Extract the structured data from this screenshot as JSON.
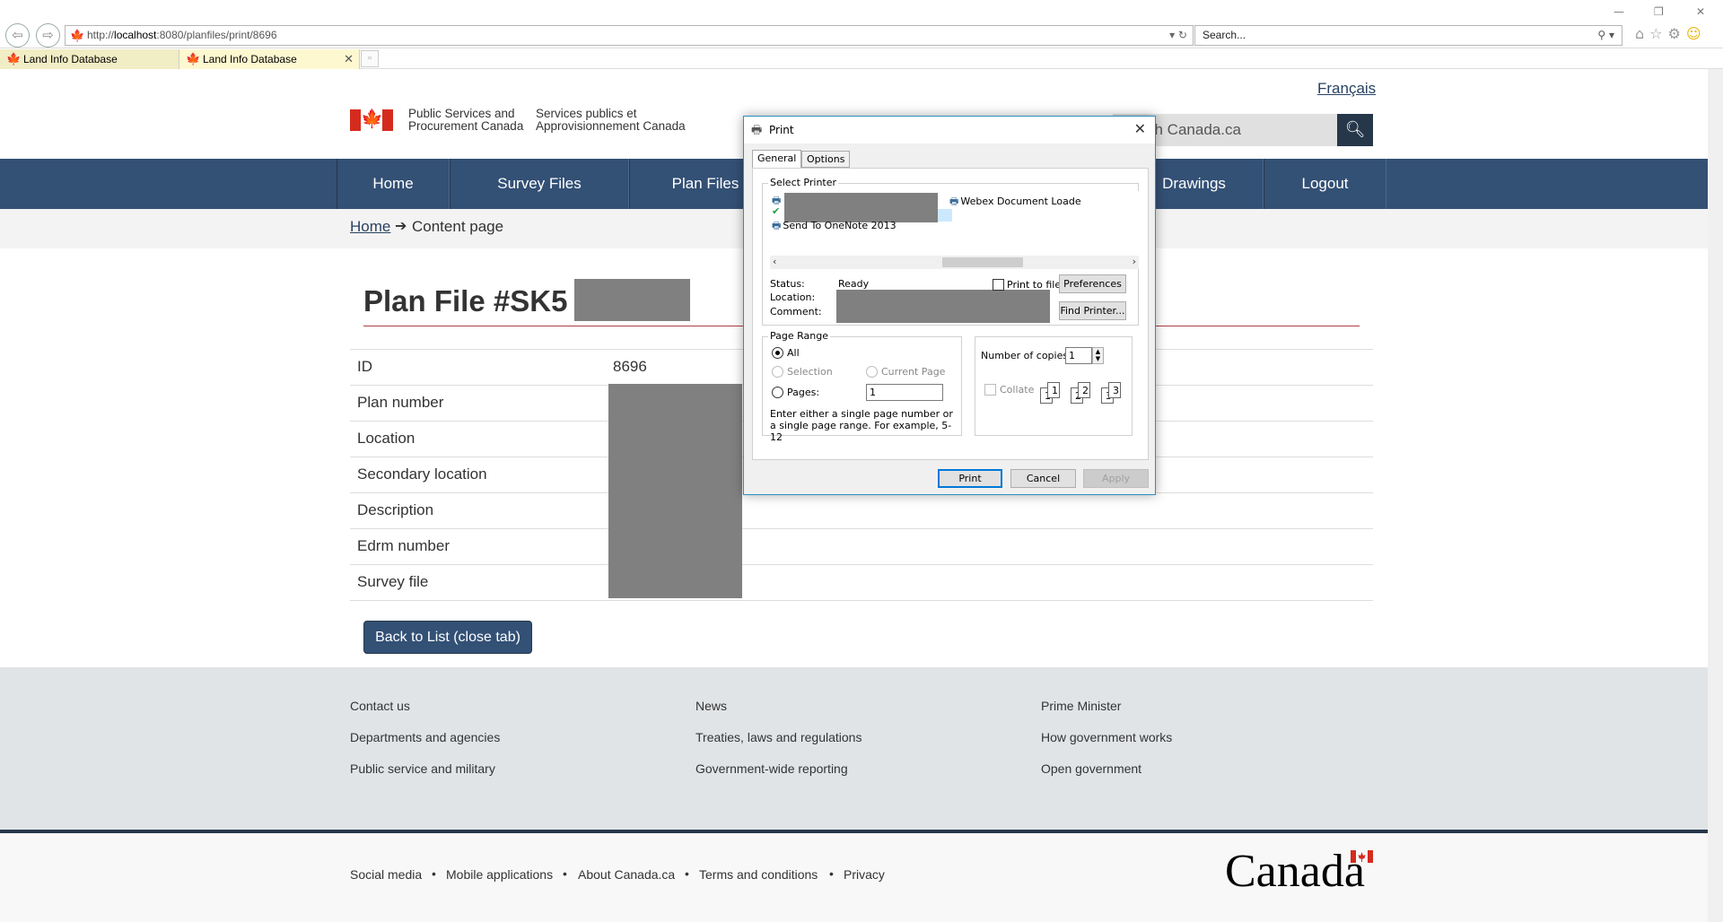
{
  "browser": {
    "url_prefix": "http://",
    "url_host": "localhost",
    "url_rest": ":8080/planfiles/print/8696",
    "search_placeholder": "Search...",
    "tabs": [
      {
        "label": "Land Info Database"
      },
      {
        "label": "Land Info Database"
      }
    ]
  },
  "header": {
    "language_link": "Français",
    "signature_en_1": "Public Services and",
    "signature_en_2": "Procurement Canada",
    "signature_fr_1": "Services publics et",
    "signature_fr_2": "Approvisionnement Canada",
    "search_placeholder": "ch Canada.ca"
  },
  "nav": {
    "items": [
      {
        "label": "Home"
      },
      {
        "label": "Survey Files"
      },
      {
        "label": "Plan Files"
      },
      {
        "label": "Drawings"
      },
      {
        "label": "Logout"
      }
    ]
  },
  "breadcrumb": {
    "home": "Home",
    "current": "Content page"
  },
  "main": {
    "title": "Plan File #SK5",
    "fields": [
      {
        "label": "ID",
        "value": "8696"
      },
      {
        "label": "Plan number",
        "value": ""
      },
      {
        "label": "Location",
        "value": ""
      },
      {
        "label": "Secondary location",
        "value": ""
      },
      {
        "label": "Description",
        "value": ""
      },
      {
        "label": "Edrm number",
        "value": ""
      },
      {
        "label": "Survey file",
        "value": ""
      }
    ],
    "back_button": "Back to List (close tab)"
  },
  "footer": {
    "col1": [
      "Contact us",
      "Departments and agencies",
      "Public service and military"
    ],
    "col2": [
      "News",
      "Treaties, laws and regulations",
      "Government-wide reporting"
    ],
    "col3": [
      "Prime Minister",
      "How government works",
      "Open government"
    ],
    "bottom_links": [
      "Social media",
      "Mobile applications",
      "About Canada.ca",
      "Terms and conditions",
      "Privacy"
    ],
    "separator": "•",
    "wordmark": "Canada"
  },
  "print_dialog": {
    "title": "Print",
    "tabs": [
      "General",
      "Options"
    ],
    "select_printer_label": "Select Printer",
    "printers": [
      "Webex Document Loade",
      "Send To OneNote 2013"
    ],
    "status_label": "Status:",
    "status_value": "Ready",
    "location_label": "Location:",
    "comment_label": "Comment:",
    "print_to_file": "Print to file",
    "preferences_button": "Preferences",
    "find_printer_button": "Find Printer...",
    "page_range_label": "Page Range",
    "range_all": "All",
    "range_selection": "Selection",
    "range_current": "Current Page",
    "range_pages": "Pages:",
    "pages_value": "1",
    "range_hint": "Enter either a single page number or a single page range.  For example, 5-12",
    "copies_label": "Number of copies:",
    "copies_value": "1",
    "collate_label": "Collate",
    "print_button": "Print",
    "cancel_button": "Cancel",
    "apply_button": "Apply"
  }
}
